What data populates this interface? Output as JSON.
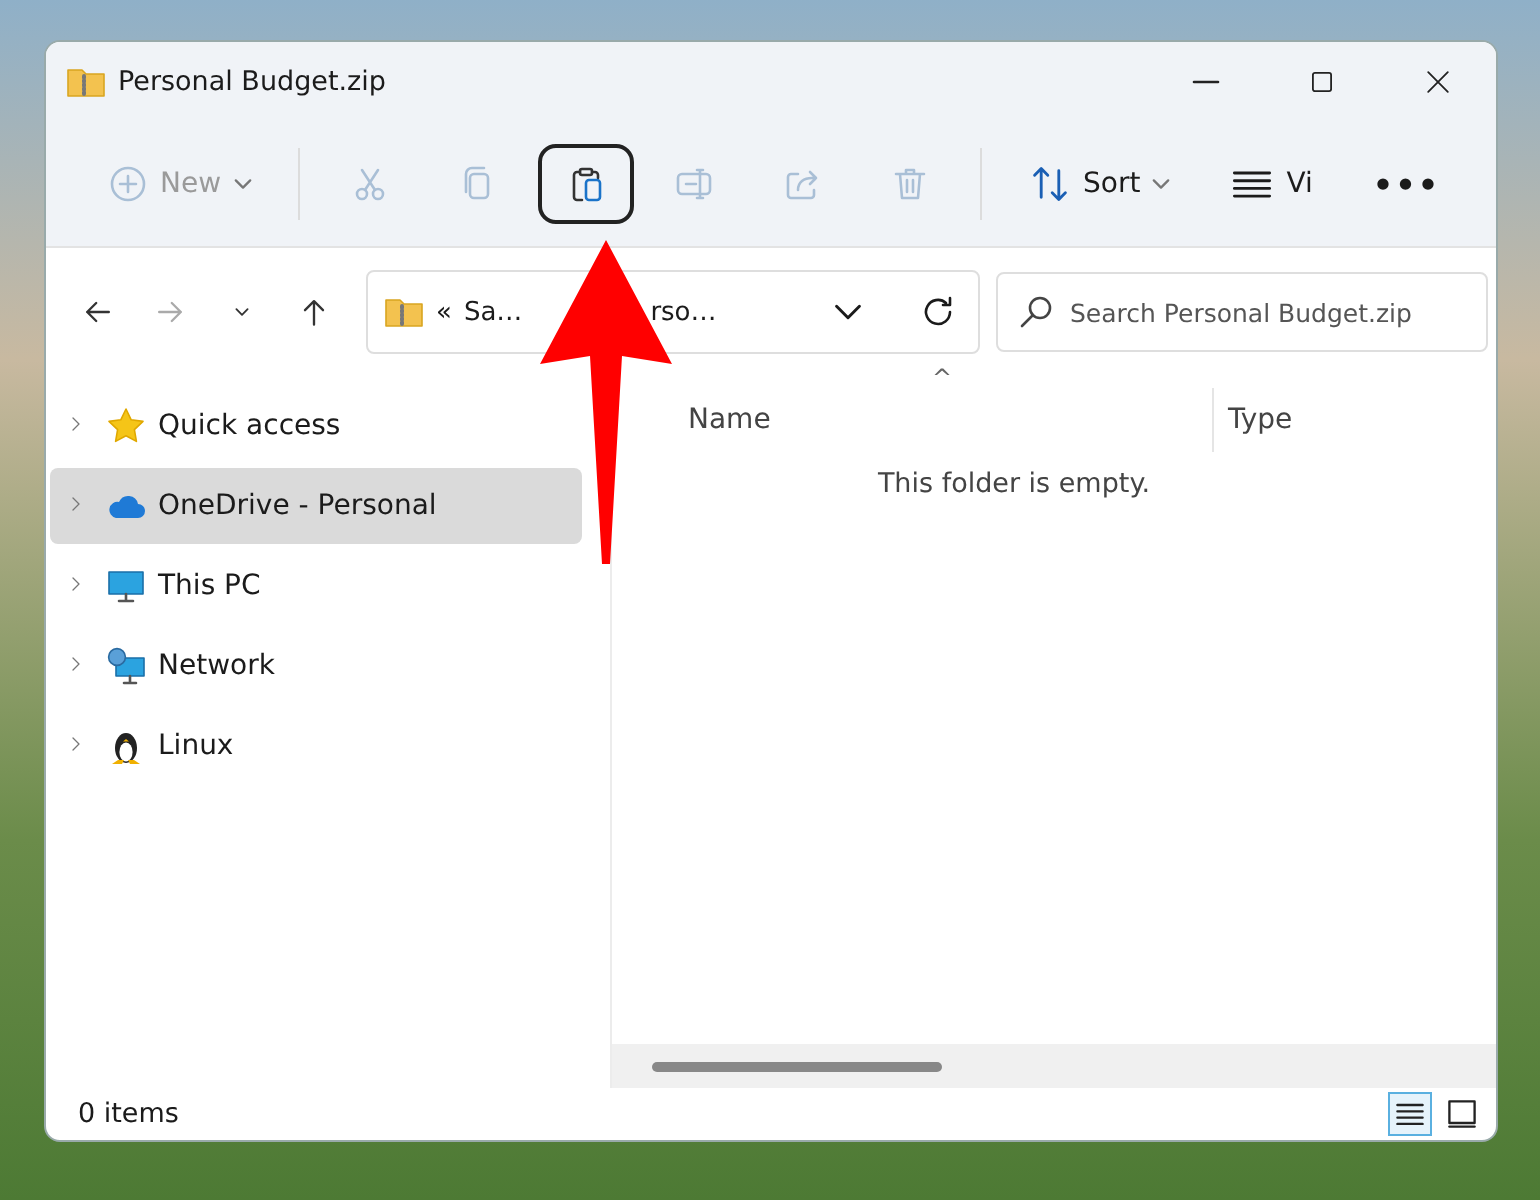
{
  "window": {
    "title": "Personal Budget.zip"
  },
  "toolbar": {
    "items": [
      {
        "kind": "new",
        "label": "New",
        "disabled": true
      },
      {
        "kind": "cut",
        "disabled": true
      },
      {
        "kind": "copy",
        "disabled": true
      },
      {
        "kind": "paste",
        "disabled": false,
        "highlighted": true
      },
      {
        "kind": "rename",
        "disabled": true
      },
      {
        "kind": "share",
        "disabled": true
      },
      {
        "kind": "delete",
        "disabled": true
      },
      {
        "kind": "sort",
        "label": "Sort",
        "disabled": false
      },
      {
        "kind": "view",
        "label": "Vi",
        "disabled": false
      },
      {
        "kind": "more",
        "label": "•••",
        "disabled": false
      }
    ]
  },
  "navigation": {
    "back_disabled": false,
    "forward_disabled": true
  },
  "address_bar": {
    "overflow": "«",
    "segments": [
      "Sa…",
      "rso…"
    ]
  },
  "search": {
    "placeholder": "Search Personal Budget.zip"
  },
  "sidebar": {
    "items": [
      {
        "kind": "star",
        "label": "Quick access",
        "selected": false
      },
      {
        "kind": "cloud",
        "label": "OneDrive - Personal",
        "selected": true
      },
      {
        "kind": "pc",
        "label": "This PC",
        "selected": false
      },
      {
        "kind": "network",
        "label": "Network",
        "selected": false
      },
      {
        "kind": "linux",
        "label": "Linux",
        "selected": false
      }
    ]
  },
  "content": {
    "columns": [
      "Name",
      "Type"
    ],
    "sort_caret": "^",
    "empty_message": "This folder is empty."
  },
  "status_bar": {
    "items_count": "0 items",
    "views": [
      {
        "kind": "details",
        "selected": true
      },
      {
        "kind": "tiles",
        "selected": false
      }
    ]
  }
}
